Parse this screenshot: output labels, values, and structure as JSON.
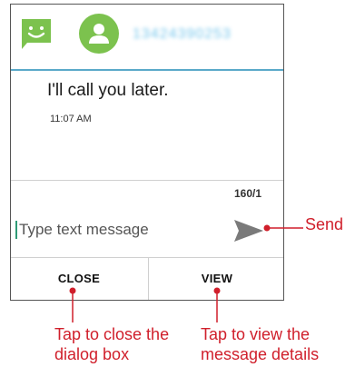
{
  "dialog": {
    "sender_number": "13424390253",
    "message_text": "I'll call you later.",
    "timestamp": "11:07 AM",
    "char_counter": "160/1",
    "input_placeholder": "Type text message",
    "close_label": "CLOSE",
    "view_label": "VIEW"
  },
  "annotations": {
    "send": "Send",
    "close": "Tap to close the dialog box",
    "view": "Tap to view the message details"
  },
  "colors": {
    "accent_red": "#d01f2b",
    "header_rule": "#5aa9c9",
    "message_icon": "#7cc24e",
    "avatar": "#7cc24e"
  },
  "icons": [
    "message-icon",
    "avatar-icon",
    "send-icon"
  ]
}
